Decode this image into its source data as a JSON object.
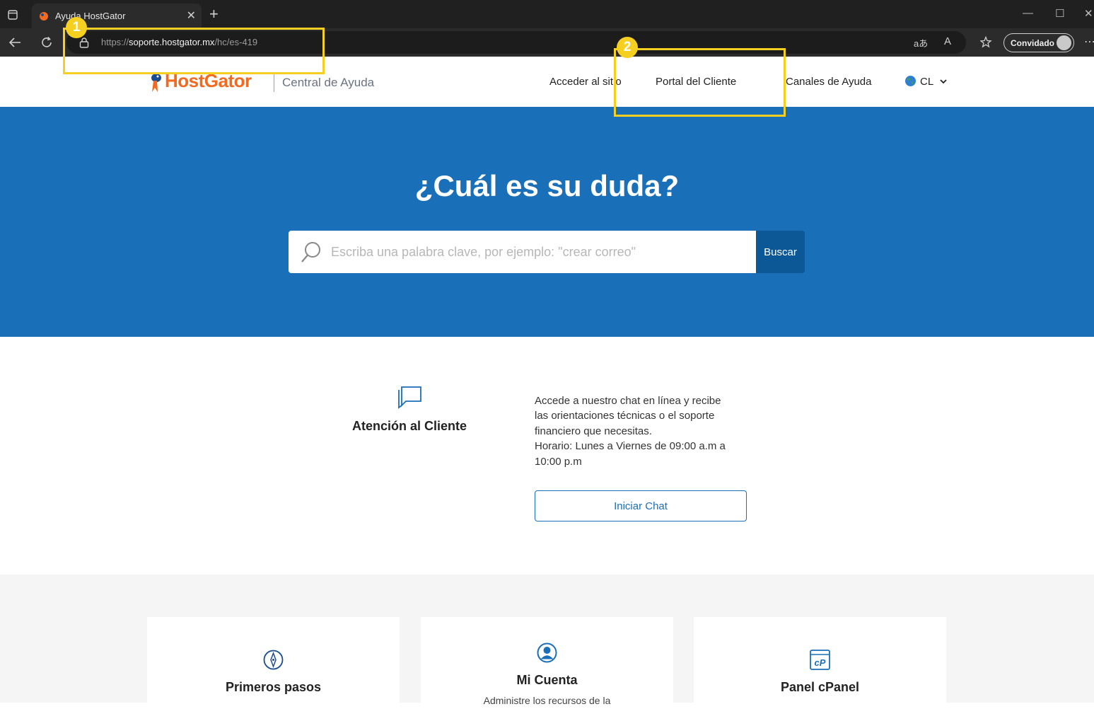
{
  "browser": {
    "tab_title": "Ayuda HostGator",
    "url_prefix": "https://",
    "url_host": "soporte.hostgator.mx",
    "url_path": "/hc/es-419",
    "profile_label": "Convidado",
    "aa_label": "aあ",
    "read_label": "A"
  },
  "header": {
    "logo_text": "HostGator",
    "logo_subtitle": "Central de Ayuda",
    "nav": {
      "access": "Acceder al sitio",
      "portal": "Portal del Cliente",
      "channels": "Canales de Ayuda",
      "region": "CL"
    }
  },
  "hero": {
    "title": "¿Cuál es su duda?",
    "search_placeholder": "Escriba una palabra clave, por ejemplo: \"crear correo\"",
    "search_button": "Buscar"
  },
  "support": {
    "title": "Atención al Cliente",
    "lines": [
      "Accede a nuestro chat en línea y recibe",
      "las orientaciones técnicas o el soporte",
      "financiero que necesitas.",
      "Horario: Lunes a Viernes de 09:00 a.m a",
      "10:00 p.m"
    ],
    "chat_button": "Iniciar Chat"
  },
  "cards": [
    {
      "title": "Primeros pasos",
      "icon": "compass-icon"
    },
    {
      "title": "Mi Cuenta",
      "desc": "Administre los recursos de la",
      "icon": "user-icon"
    },
    {
      "title": "Panel cPanel",
      "icon": "cpanel-icon"
    }
  ],
  "annotations": {
    "badge1": "1",
    "badge2": "2",
    "color": "#f5d020"
  },
  "colors": {
    "brand_orange": "#f26a21",
    "hero_blue": "#1a6fb9",
    "button_dark": "#0c5896"
  }
}
